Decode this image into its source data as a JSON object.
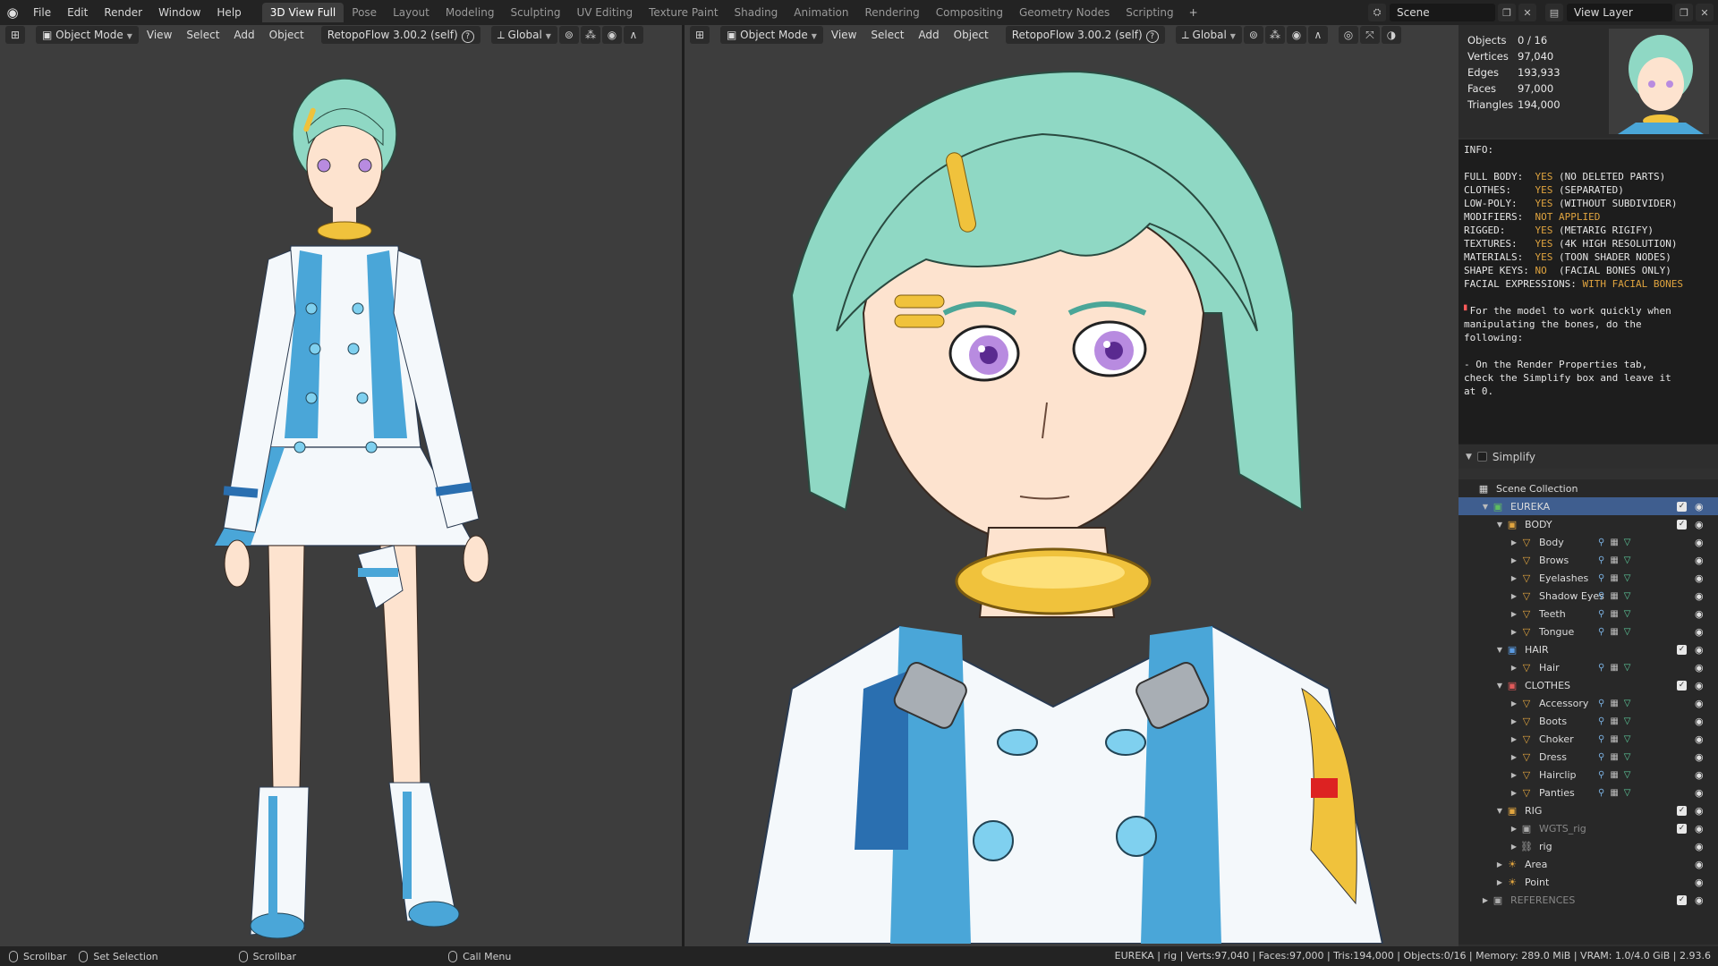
{
  "topbar": {
    "menus": [
      "File",
      "Edit",
      "Render",
      "Window",
      "Help"
    ],
    "workspaces": [
      "3D View Full",
      "Pose",
      "Layout",
      "Modeling",
      "Sculpting",
      "UV Editing",
      "Texture Paint",
      "Shading",
      "Animation",
      "Rendering",
      "Compositing",
      "Geometry Nodes",
      "Scripting"
    ],
    "active_workspace": "3D View Full",
    "add_tab": "+",
    "scene": "Scene",
    "view_layer": "View Layer"
  },
  "viewport_left": {
    "mode": "Object Mode",
    "menus": [
      "View",
      "Select",
      "Add",
      "Object"
    ],
    "addon": "RetopoFlow 3.00.2 (self)",
    "orientation": "Global"
  },
  "viewport_right": {
    "mode": "Object Mode",
    "menus": [
      "View",
      "Select",
      "Add",
      "Object"
    ],
    "addon": "RetopoFlow 3.00.2 (self)",
    "orientation": "Global"
  },
  "stats": [
    {
      "label": "Objects",
      "value": "0 / 16"
    },
    {
      "label": "Vertices",
      "value": "97,040"
    },
    {
      "label": "Edges",
      "value": "193,933"
    },
    {
      "label": "Faces",
      "value": "97,000"
    },
    {
      "label": "Triangles",
      "value": "194,000"
    }
  ],
  "info_text": {
    "header": "INFO:",
    "lines": [
      {
        "k": "FULL BODY:  ",
        "v": "YES ",
        "n": "(NO DELETED PARTS)"
      },
      {
        "k": "CLOTHES:    ",
        "v": "YES ",
        "n": "(SEPARATED)"
      },
      {
        "k": "LOW-POLY:   ",
        "v": "YES ",
        "n": "(WITHOUT SUBDIVIDER)"
      },
      {
        "k": "MODIFIERS:  ",
        "v": "NOT APPLIED",
        "n": ""
      },
      {
        "k": "RIGGED:     ",
        "v": "YES ",
        "n": "(METARIG RIGIFY)"
      },
      {
        "k": "TEXTURES:   ",
        "v": "YES ",
        "n": "(4K HIGH RESOLUTION)"
      },
      {
        "k": "MATERIALS:  ",
        "v": "YES ",
        "n": "(TOON SHADER NODES)"
      },
      {
        "k": "SHAPE KEYS: ",
        "v": "NO  ",
        "n": "(FACIAL BONES ONLY)"
      },
      {
        "k": "FACIAL EXPRESSIONS: ",
        "v": "WITH FACIAL BONES",
        "n": ""
      }
    ],
    "note1": [
      "For the model to work quickly when",
      "manipulating the bones, do the",
      "following:"
    ],
    "note2": [
      "- On the Render Properties tab,",
      "check the Simplify box and leave it",
      "at 0."
    ]
  },
  "simplify": {
    "label": "Simplify"
  },
  "outliner": {
    "root": "Scene Collection",
    "rows": [
      {
        "label": "EUREKA",
        "kind": "collection",
        "color": "#5fbf5f",
        "depth": 1,
        "selected": true,
        "checked": true
      },
      {
        "label": "BODY",
        "kind": "collection",
        "color": "#e0a43f",
        "depth": 2,
        "checked": true
      },
      {
        "label": "Body",
        "kind": "mesh",
        "depth": 3
      },
      {
        "label": "Brows",
        "kind": "mesh",
        "depth": 3
      },
      {
        "label": "Eyelashes",
        "kind": "mesh",
        "depth": 3
      },
      {
        "label": "Shadow Eyes",
        "kind": "mesh",
        "depth": 3
      },
      {
        "label": "Teeth",
        "kind": "mesh",
        "depth": 3
      },
      {
        "label": "Tongue",
        "kind": "mesh",
        "depth": 3
      },
      {
        "label": "HAIR",
        "kind": "collection",
        "color": "#5a9ae0",
        "depth": 2,
        "checked": true
      },
      {
        "label": "Hair",
        "kind": "mesh",
        "depth": 3
      },
      {
        "label": "CLOTHES",
        "kind": "collection",
        "color": "#e05a5a",
        "depth": 2,
        "checked": true
      },
      {
        "label": "Accessory",
        "kind": "mesh",
        "depth": 3
      },
      {
        "label": "Boots",
        "kind": "mesh",
        "depth": 3
      },
      {
        "label": "Choker",
        "kind": "mesh",
        "depth": 3
      },
      {
        "label": "Dress",
        "kind": "mesh",
        "depth": 3
      },
      {
        "label": "Hairclip",
        "kind": "mesh",
        "depth": 3
      },
      {
        "label": "Panties",
        "kind": "mesh",
        "depth": 3
      },
      {
        "label": "RIG",
        "kind": "collection",
        "color": "#e0a43f",
        "depth": 2,
        "checked": true
      },
      {
        "label": "WGTS_rig",
        "kind": "collection-dim",
        "depth": 3,
        "checked": true
      },
      {
        "label": "rig",
        "kind": "armature",
        "depth": 3
      },
      {
        "label": "Area",
        "kind": "light",
        "depth": 2
      },
      {
        "label": "Point",
        "kind": "light",
        "depth": 2
      },
      {
        "label": "REFERENCES",
        "kind": "collection-dim",
        "depth": 1,
        "checked": true
      }
    ]
  },
  "statusbar": {
    "left1": "Scrollbar",
    "left2": "Set Selection",
    "left3": "Scrollbar",
    "left4": "Call Menu",
    "right": "EUREKA | rig | Verts:97,040 | Faces:97,000 | Tris:194,000 | Objects:0/16 | Memory: 289.0 MiB | VRAM: 1.0/4.0 GiB | 2.93.6"
  },
  "colors": {
    "viewport_bg": "#3d3d3d",
    "selection": "#3f5e8f",
    "hair": "#8fd8c4",
    "skin": "#fde3cf",
    "accent_blue": "#4aa6d8",
    "gold": "#f0c23c"
  }
}
